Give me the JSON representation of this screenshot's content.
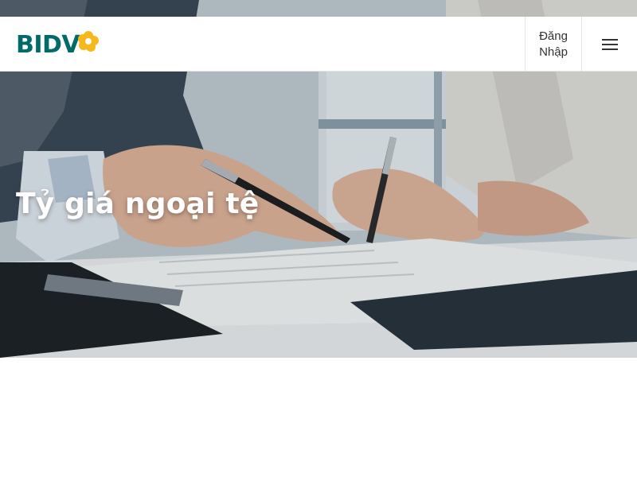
{
  "header": {
    "logo_text": "BIDV",
    "login_line1": "Đăng",
    "login_line2": "Nhập",
    "menu_icon": "hamburger-menu-icon"
  },
  "hero": {
    "title": "Tỷ giá ngoại tệ",
    "image_subject": "business people signing a document"
  },
  "colors": {
    "brand": "#006b68",
    "logo_mark": "#f6b81a",
    "hero_title": "#ffffff"
  }
}
